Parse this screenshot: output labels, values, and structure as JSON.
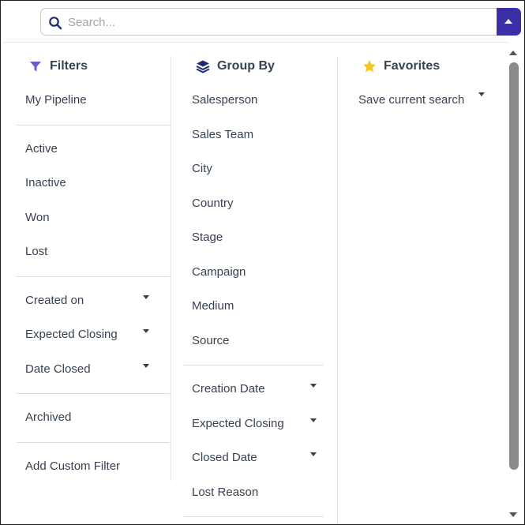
{
  "search": {
    "placeholder": "Search...",
    "icon": "search-icon",
    "toggle_icon": "caret-up-icon"
  },
  "colors": {
    "accent": "#3b2fa8",
    "filter_icon": "#6d5bd0",
    "group_icon": "#1e2a78",
    "star": "#f5c518"
  },
  "filters": {
    "title": "Filters",
    "icon": "funnel-icon",
    "groups": [
      [
        {
          "label": "My Pipeline"
        }
      ],
      [
        {
          "label": "Active"
        },
        {
          "label": "Inactive"
        },
        {
          "label": "Won"
        },
        {
          "label": "Lost"
        }
      ],
      [
        {
          "label": "Created on",
          "dropdown": true
        },
        {
          "label": "Expected Closing",
          "dropdown": true
        },
        {
          "label": "Date Closed",
          "dropdown": true
        }
      ],
      [
        {
          "label": "Archived"
        }
      ],
      [
        {
          "label": "Add Custom Filter"
        }
      ]
    ]
  },
  "group_by": {
    "title": "Group By",
    "icon": "layers-icon",
    "groups": [
      [
        {
          "label": "Salesperson"
        },
        {
          "label": "Sales Team"
        },
        {
          "label": "City"
        },
        {
          "label": "Country"
        },
        {
          "label": "Stage"
        },
        {
          "label": "Campaign"
        },
        {
          "label": "Medium"
        },
        {
          "label": "Source"
        }
      ],
      [
        {
          "label": "Creation Date",
          "dropdown": true
        },
        {
          "label": "Expected Closing",
          "dropdown": true
        },
        {
          "label": "Closed Date",
          "dropdown": true
        },
        {
          "label": "Lost Reason"
        }
      ]
    ]
  },
  "favorites": {
    "title": "Favorites",
    "icon": "star-icon",
    "items": [
      {
        "label": "Save current search",
        "dropdown": true
      }
    ]
  }
}
